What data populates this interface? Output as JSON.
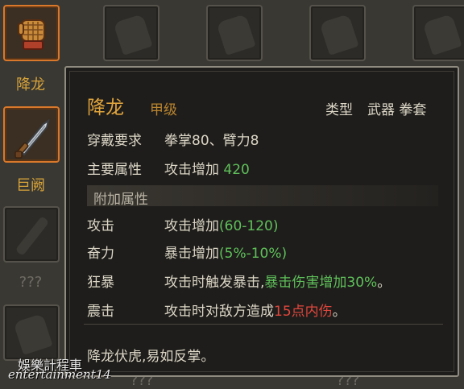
{
  "inventory": {
    "slot1_label": "降龙",
    "slot2_label": "巨阙",
    "slot3_label": "???",
    "slot4_label": "???",
    "slot5_label": "???"
  },
  "tooltip": {
    "name": "降龙",
    "grade": "甲级",
    "type_label": "类型",
    "type_value": "武器 拳套",
    "req_label": "穿戴要求",
    "req_value": "拳掌80、臂力8",
    "main_label": "主要属性",
    "main_text": "攻击增加",
    "main_value": "420",
    "extra_header": "附加属性",
    "attrs": [
      {
        "name": "攻击",
        "text": "攻击增加",
        "value": "(60-120)"
      },
      {
        "name": "奋力",
        "text": "暴击增加",
        "value": "(5%-10%)"
      },
      {
        "name": "狂暴",
        "text": "攻击时触发暴击,",
        "value": "暴击伤害增加30%",
        "tail": "。"
      },
      {
        "name": "震击",
        "text": "攻击时对敌方造成",
        "value": "15点内伤",
        "tail": "。"
      }
    ],
    "description": "降龙伏虎,易如反掌。"
  },
  "watermark": {
    "line1": "娛樂計程車",
    "line2": "entertainment14"
  },
  "colors": {
    "gold": "#e0a43c",
    "green": "#5fc05a",
    "red": "#e0463c",
    "selected_border": "#d9782a"
  }
}
